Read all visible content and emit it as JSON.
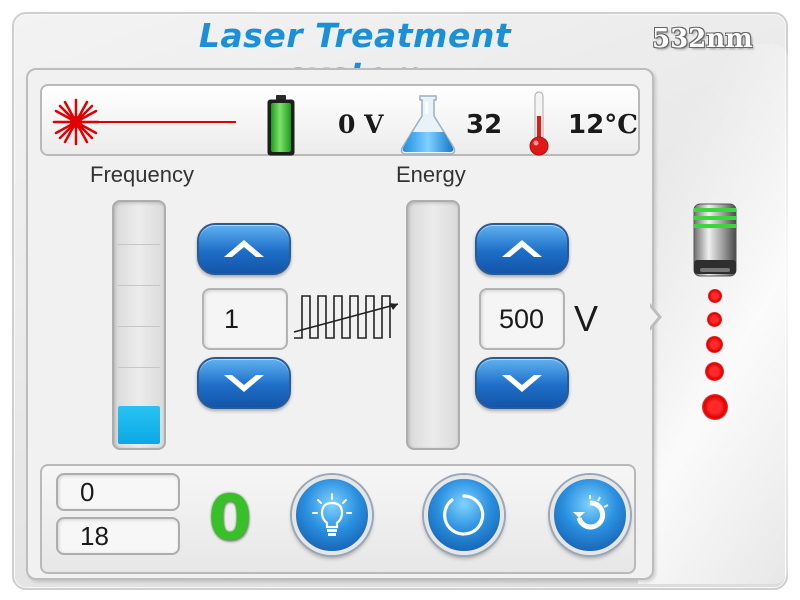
{
  "header": {
    "title": "Laser Treatment system",
    "wavelength": "532nm"
  },
  "status": {
    "voltage": "0 V",
    "water_level": "32",
    "temperature": "12",
    "temperature_unit": "°C"
  },
  "frequency": {
    "label": "Frequency",
    "value": "1",
    "gauge_level": 0.16
  },
  "energy": {
    "label": "Energy",
    "value": "500",
    "unit": "V",
    "gauge_level": 0
  },
  "counters": {
    "top": "0",
    "bottom": "18",
    "mode_glyph": "0"
  },
  "colors": {
    "accent": "#1c8fd6",
    "gauge_fill": "#0aa8e6",
    "button_blue": "#1d6ec8",
    "ready_green": "#38c028",
    "laser_red": "#e00000"
  },
  "icons": {
    "laser": "laser-beam-icon",
    "battery": "battery-full-icon",
    "flask": "water-flask-icon",
    "thermometer": "thermometer-icon",
    "pulse": "pulse-train-icon",
    "light": "light-bulb-icon",
    "standby": "power-ring-icon",
    "reset": "refresh-icon",
    "handpiece": "handpiece-icon"
  }
}
